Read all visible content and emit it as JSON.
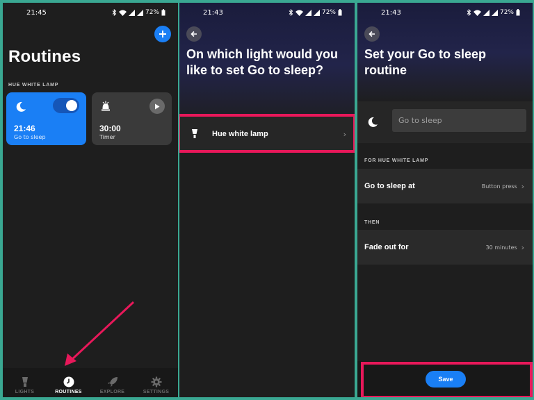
{
  "screens": [
    {
      "status": {
        "time": "21:45",
        "battery": "72%"
      },
      "title": "Routines",
      "section_label": "HUE WHITE LAMP",
      "cards": [
        {
          "time": "21:46",
          "subtitle": "Go to sleep",
          "icon": "moon-zz-icon",
          "toggle_on": true
        },
        {
          "time": "30:00",
          "subtitle": "Timer",
          "icon": "bell-timer-icon"
        }
      ],
      "nav": [
        {
          "label": "LIGHTS",
          "icon": "bulb-icon",
          "active": false
        },
        {
          "label": "ROUTINES",
          "icon": "clock-icon",
          "active": true
        },
        {
          "label": "EXPLORE",
          "icon": "rocket-icon",
          "active": false
        },
        {
          "label": "SETTINGS",
          "icon": "gear-icon",
          "active": false
        }
      ]
    },
    {
      "status": {
        "time": "21:43",
        "battery": "72%"
      },
      "title": "On which light would you like to set Go to sleep?",
      "light_option": {
        "label": "Hue white lamp",
        "icon": "lamp-icon"
      }
    },
    {
      "status": {
        "time": "21:43",
        "battery": "72%"
      },
      "title": "Set your Go to sleep routine",
      "name_placeholder": "Go to sleep",
      "section_for": "FOR HUE WHITE LAMP",
      "go_to_sleep_row": {
        "label": "Go to sleep at",
        "value": "Button press"
      },
      "section_then": "THEN",
      "fade_row": {
        "label": "Fade out for",
        "value": "30 minutes"
      },
      "save_label": "Save"
    }
  ],
  "colors": {
    "accent": "#1a7ff5",
    "highlight": "#e8185a",
    "frame": "#3aa892",
    "background": "#1e1e1e"
  }
}
